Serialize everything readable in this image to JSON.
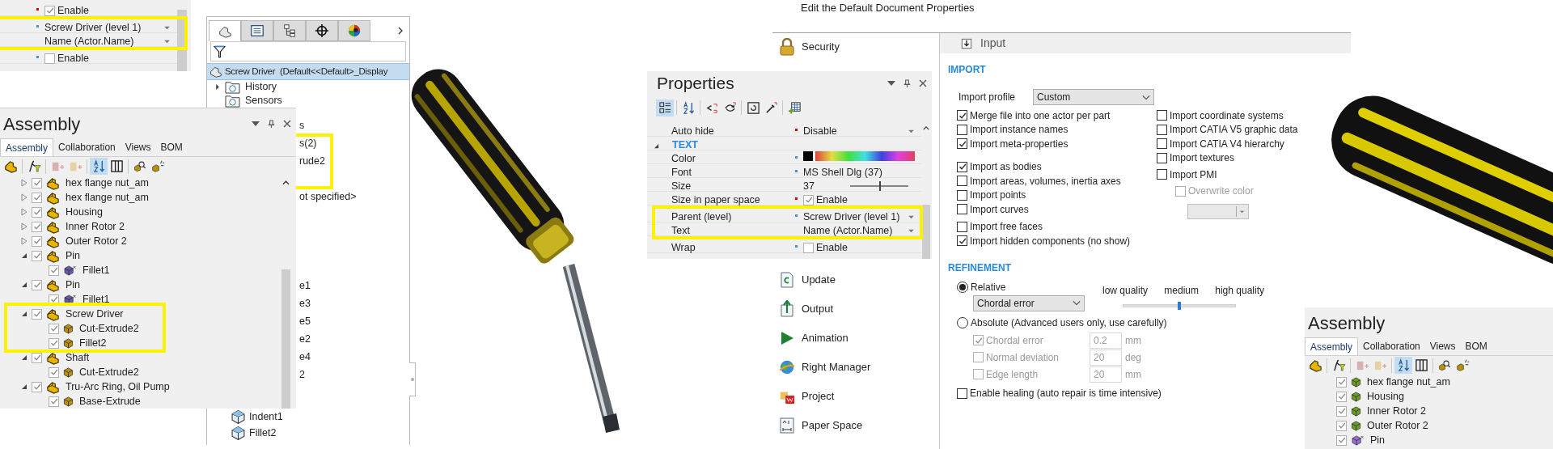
{
  "property_fragment": {
    "rows": [
      {
        "kind": "checkbox",
        "value": "Enable",
        "checked": true,
        "color": "#e00000",
        "highlighted": false
      },
      {
        "kind": "dropdown",
        "value": "Screw Driver (level 1)",
        "color": "#4a90d0",
        "highlighted": true
      },
      {
        "kind": "dropdown",
        "value": "Name (Actor.Name)",
        "highlighted": true
      },
      {
        "kind": "checkbox",
        "value": "Enable",
        "checked": false,
        "color": "#4a90d0",
        "highlighted": false
      }
    ]
  },
  "feature_tree": {
    "tabs": [
      {
        "kind": "part",
        "selected": true
      },
      {
        "kind": "list",
        "selected": false
      },
      {
        "kind": "tree",
        "selected": false
      },
      {
        "kind": "target",
        "selected": false
      },
      {
        "kind": "appearance",
        "selected": false
      }
    ],
    "root": "Screw Driver  (Default<<Default>_Display",
    "items": [
      {
        "label": "History",
        "expanded": false
      },
      {
        "label": "Sensors"
      }
    ],
    "fragment_groups": [
      {
        "kind": "text",
        "items": [
          {
            "text": "s",
            "highlighted": false
          },
          {
            "text": "s(2)",
            "highlighted": true
          },
          {
            "text": "rude2",
            "highlighted": true
          }
        ]
      },
      {
        "kind": "text",
        "items": [
          {
            "text": "ot specified>",
            "highlighted": false
          }
        ]
      },
      {
        "kind": "text",
        "items": [
          {
            "text": "e1",
            "highlighted": false
          },
          {
            "text": "e3",
            "highlighted": false
          },
          {
            "text": "e5",
            "highlighted": false
          },
          {
            "text": "e2",
            "highlighted": false
          },
          {
            "text": "e4",
            "highlighted": false
          },
          {
            "text": "2",
            "highlighted": false
          }
        ]
      },
      {
        "kind": "feature",
        "items": [
          {
            "text": "Indent1",
            "highlighted": false
          },
          {
            "text": "Fillet2",
            "highlighted": false
          }
        ]
      }
    ]
  },
  "assembly_left": {
    "title": "Assembly",
    "tabs": [
      {
        "label": "Assembly",
        "selected": true
      },
      {
        "label": "Collaboration",
        "selected": false
      },
      {
        "label": "Views",
        "selected": false
      },
      {
        "label": "BOM",
        "selected": false
      }
    ],
    "toolbar": [
      {
        "kind": "assembly",
        "selected": false
      },
      {
        "kind": "filter",
        "selected": false
      },
      {
        "kind": "insert-part",
        "selected": false
      },
      {
        "kind": "insert-assembly",
        "selected": false
      },
      {
        "kind": "sort",
        "selected": true
      },
      {
        "kind": "columns",
        "selected": false
      },
      {
        "kind": "search",
        "selected": false
      },
      {
        "kind": "explode",
        "selected": false
      }
    ],
    "items": [
      {
        "label": "hex flange nut_am",
        "kind": "assembly",
        "checked": true,
        "expanded": false,
        "highlighted": false
      },
      {
        "label": "hex flange nut_am",
        "kind": "assembly",
        "checked": true,
        "expanded": false,
        "highlighted": false
      },
      {
        "label": "Housing",
        "kind": "assembly",
        "checked": true,
        "expanded": false,
        "highlighted": false
      },
      {
        "label": "Inner Rotor 2",
        "kind": "assembly",
        "checked": true,
        "expanded": false,
        "highlighted": false
      },
      {
        "label": "Outer Rotor 2",
        "kind": "assembly",
        "checked": true,
        "expanded": false,
        "highlighted": false
      },
      {
        "label": "Pin",
        "kind": "assembly",
        "checked": true,
        "expanded": true,
        "highlighted": false,
        "children": [
          {
            "label": "Fillet1",
            "kind": "part",
            "checked": true,
            "color": "#6a5aa8",
            "modified": true
          }
        ]
      },
      {
        "label": "Pin",
        "kind": "assembly",
        "checked": true,
        "expanded": true,
        "highlighted": false,
        "children": [
          {
            "label": "Fillet1",
            "kind": "part",
            "checked": true,
            "color": "#6a5aa8",
            "modified": true
          }
        ]
      },
      {
        "label": "Screw Driver",
        "kind": "assembly",
        "checked": true,
        "expanded": true,
        "highlighted": true,
        "children": [
          {
            "label": "Cut-Extrude2",
            "kind": "part",
            "checked": true,
            "color": "#b8900a",
            "modified": false
          },
          {
            "label": "Fillet2",
            "kind": "part",
            "checked": true,
            "color": "#b8900a",
            "modified": false
          }
        ]
      },
      {
        "label": "Shaft",
        "kind": "assembly",
        "checked": true,
        "expanded": true,
        "highlighted": false,
        "children": [
          {
            "label": "Cut-Extrude2",
            "kind": "part",
            "checked": true,
            "color": "#b8900a",
            "modified": false
          }
        ]
      },
      {
        "label": "Tru-Arc Ring, Oil Pump",
        "kind": "assembly",
        "checked": true,
        "expanded": true,
        "highlighted": false,
        "children": [
          {
            "label": "Base-Extrude",
            "kind": "part",
            "checked": true,
            "color": "#b8900a",
            "modified": false
          }
        ]
      }
    ]
  },
  "properties": {
    "title": "Properties",
    "toolbar": [
      {
        "kind": "categorized",
        "selected": true
      },
      {
        "kind": "sort",
        "selected": false
      },
      {
        "kind": "collapse",
        "selected": false
      },
      {
        "kind": "expand",
        "selected": false
      },
      {
        "kind": "refresh",
        "selected": false
      },
      {
        "kind": "picker",
        "selected": false
      },
      {
        "kind": "add-table",
        "selected": false
      }
    ],
    "rows": [
      {
        "kind": "dropdown",
        "label": "Auto hide",
        "value": "Disable",
        "color": "#e00000",
        "highlighted": false
      },
      {
        "kind": "header",
        "label": "TEXT",
        "expanded": true,
        "highlighted": false
      },
      {
        "kind": "color",
        "label": "Color",
        "color": "#4a90d0",
        "highlighted": false
      },
      {
        "kind": "text",
        "label": "Font",
        "value": "MS Shell Dlg (37)",
        "color": "#4a90d0",
        "highlighted": false
      },
      {
        "kind": "slider",
        "label": "Size",
        "value": "37",
        "level": 0.5,
        "highlighted": false
      },
      {
        "kind": "checkbox",
        "label": "Size in paper space",
        "value": "Enable",
        "checked": true,
        "color": "#e00000",
        "highlighted": false
      },
      {
        "kind": "dropdown",
        "label": "Parent (level)",
        "value": "Screw Driver (level 1)",
        "color": "#4a90d0",
        "highlighted": true
      },
      {
        "kind": "dropdown",
        "label": "Text",
        "value": "Name (Actor.Name)",
        "highlighted": true
      },
      {
        "kind": "checkbox",
        "label": "Wrap",
        "value": "Enable",
        "checked": false,
        "color": "#4a90d0",
        "highlighted": false
      }
    ]
  },
  "document_properties": {
    "title": "Edit the Default Document Properties",
    "nav_top": [
      {
        "label": "Security",
        "kind": "security"
      }
    ],
    "nav_bottom": [
      {
        "label": "Update",
        "kind": "update"
      },
      {
        "label": "Output",
        "kind": "output"
      },
      {
        "label": "Animation",
        "kind": "animation"
      },
      {
        "label": "Right Manager",
        "kind": "globe"
      },
      {
        "label": "Project",
        "kind": "project"
      },
      {
        "label": "Paper Space",
        "kind": "paper"
      }
    ],
    "page_title": "Input",
    "import": {
      "heading": "IMPORT",
      "profile_label": "Import profile",
      "profile_value": "Custom",
      "left_option_groups": [
        [
          {
            "label": "Merge file into one actor per part",
            "checked": true
          },
          {
            "label": "Import instance names",
            "checked": false
          },
          {
            "label": "Import meta-properties",
            "checked": true
          }
        ],
        [
          {
            "label": "Import as bodies",
            "checked": true
          },
          {
            "label": "Import areas, volumes, inertia axes",
            "checked": false
          },
          {
            "label": "Import points",
            "checked": false
          },
          {
            "label": "Import curves",
            "checked": false
          }
        ],
        [
          {
            "label": "Import free faces",
            "checked": false
          },
          {
            "label": "Import hidden components (no show)",
            "checked": true
          }
        ]
      ],
      "right_options": [
        {
          "label": "Import coordinate systems",
          "checked": false,
          "disabled": false
        },
        {
          "label": "Import CATIA V5 graphic data",
          "checked": false,
          "disabled": false
        },
        {
          "label": "Import CATIA V4 hierarchy",
          "checked": false,
          "disabled": false
        },
        {
          "label": "Import textures",
          "checked": false,
          "disabled": false
        },
        {
          "label": "Import PMI",
          "checked": false,
          "disabled": false
        },
        {
          "label": "Overwrite color",
          "checked": false,
          "disabled": true
        }
      ]
    },
    "refinement": {
      "heading": "REFINEMENT",
      "modes": [
        {
          "label": "Relative",
          "selected": true
        },
        {
          "label": "Absolute (Advanced users only, use carefully)",
          "selected": false
        }
      ],
      "method": "Chordal error",
      "quality_labels": [
        "low quality",
        "medium",
        "high quality"
      ],
      "quality": {
        "level": 0.5
      },
      "absolute_disabled": true,
      "absolute_params": [
        {
          "label": "Chordal error",
          "checked": true,
          "value": "0.2",
          "unit": "mm"
        },
        {
          "label": "Normal deviation",
          "checked": false,
          "value": "20",
          "unit": "deg"
        },
        {
          "label": "Edge length",
          "checked": false,
          "value": "20",
          "unit": "mm"
        }
      ],
      "healing": {
        "label": "Enable healing (auto repair is time intensive)",
        "checked": false
      }
    }
  },
  "assembly_right": {
    "title": "Assembly",
    "tabs": [
      {
        "label": "Assembly",
        "selected": true
      },
      {
        "label": "Collaboration",
        "selected": false
      },
      {
        "label": "Views",
        "selected": false
      },
      {
        "label": "BOM",
        "selected": false
      }
    ],
    "toolbar": [
      {
        "kind": "assembly",
        "selected": false
      },
      {
        "kind": "filter",
        "selected": false
      },
      {
        "kind": "insert-part",
        "selected": false
      },
      {
        "kind": "insert-assembly",
        "selected": false
      },
      {
        "kind": "sort",
        "selected": true
      },
      {
        "kind": "columns",
        "selected": false
      },
      {
        "kind": "search",
        "selected": false
      },
      {
        "kind": "explode",
        "selected": false
      }
    ],
    "items": [
      {
        "label": "hex flange nut_am",
        "kind": "part",
        "checked": true,
        "color": "#6a9e1f",
        "modified": false
      },
      {
        "label": "Housing",
        "kind": "part",
        "checked": true,
        "color": "#6a9e1f",
        "modified": false
      },
      {
        "label": "Inner Rotor 2",
        "kind": "part",
        "checked": true,
        "color": "#6a9e1f",
        "modified": false
      },
      {
        "label": "Outer Rotor 2",
        "kind": "part",
        "checked": true,
        "color": "#6a9e1f",
        "modified": false
      },
      {
        "label": "Pin",
        "kind": "part",
        "checked": true,
        "color": "#9a6fd6",
        "modified": true
      }
    ]
  }
}
